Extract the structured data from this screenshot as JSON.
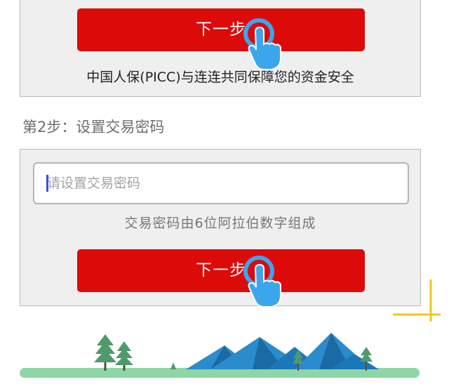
{
  "step1": {
    "next_label": "下一步",
    "insurance_note": "中国人保(PICC)与连连共同保障您的资金安全"
  },
  "step2": {
    "title": "第2步：设置交易密码",
    "password": {
      "value": "",
      "placeholder": "请设置交易密码"
    },
    "hint": "交易密码由6位阿拉伯数字组成",
    "next_label": "下一步"
  },
  "colors": {
    "button_red": "#dd0a0a",
    "hand_blue": "#3ba6ec",
    "accent_yellow": "#f3c51d",
    "ground_green": "#8fd6a7",
    "mountain_blue": "#1b78b8"
  },
  "icons": [
    "tap-hand-icon",
    "tap-hand-icon"
  ]
}
